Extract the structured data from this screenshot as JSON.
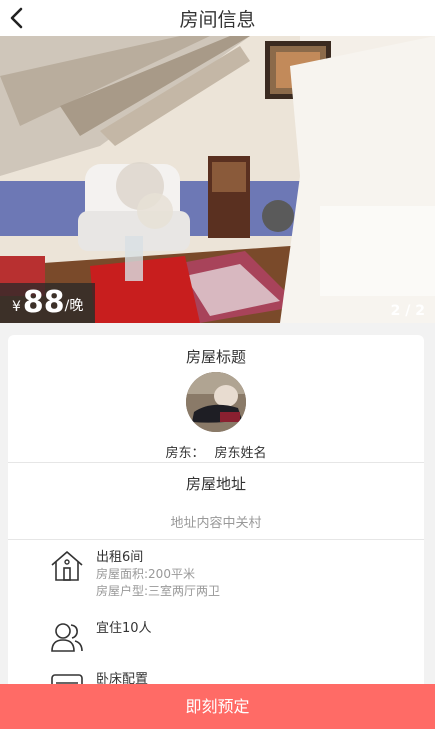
{
  "nav": {
    "title": "房间信息",
    "back_icon": "chevron-left-icon"
  },
  "hero": {
    "currency": "¥",
    "price": "88",
    "unit": "/晚",
    "pager": "2 / 2"
  },
  "host": {
    "section_title": "房屋标题",
    "label": "房东：",
    "name": "房东姓名"
  },
  "address": {
    "section_title": "房屋地址",
    "text": "地址内容中关村"
  },
  "features": [
    {
      "icon": "house-icon",
      "main": "出租6间",
      "lines": [
        "房屋面积:200平米",
        "房屋户型:三室两厅两卫"
      ]
    },
    {
      "icon": "users-icon",
      "main": "宜住10人",
      "lines": []
    },
    {
      "icon": "bed-icon",
      "main": "卧床配置",
      "lines": []
    }
  ],
  "cta": {
    "label": "即刻预定"
  },
  "colors": {
    "accent": "#ff6b66",
    "muted_text": "#999999",
    "background": "#f2f2f2"
  }
}
